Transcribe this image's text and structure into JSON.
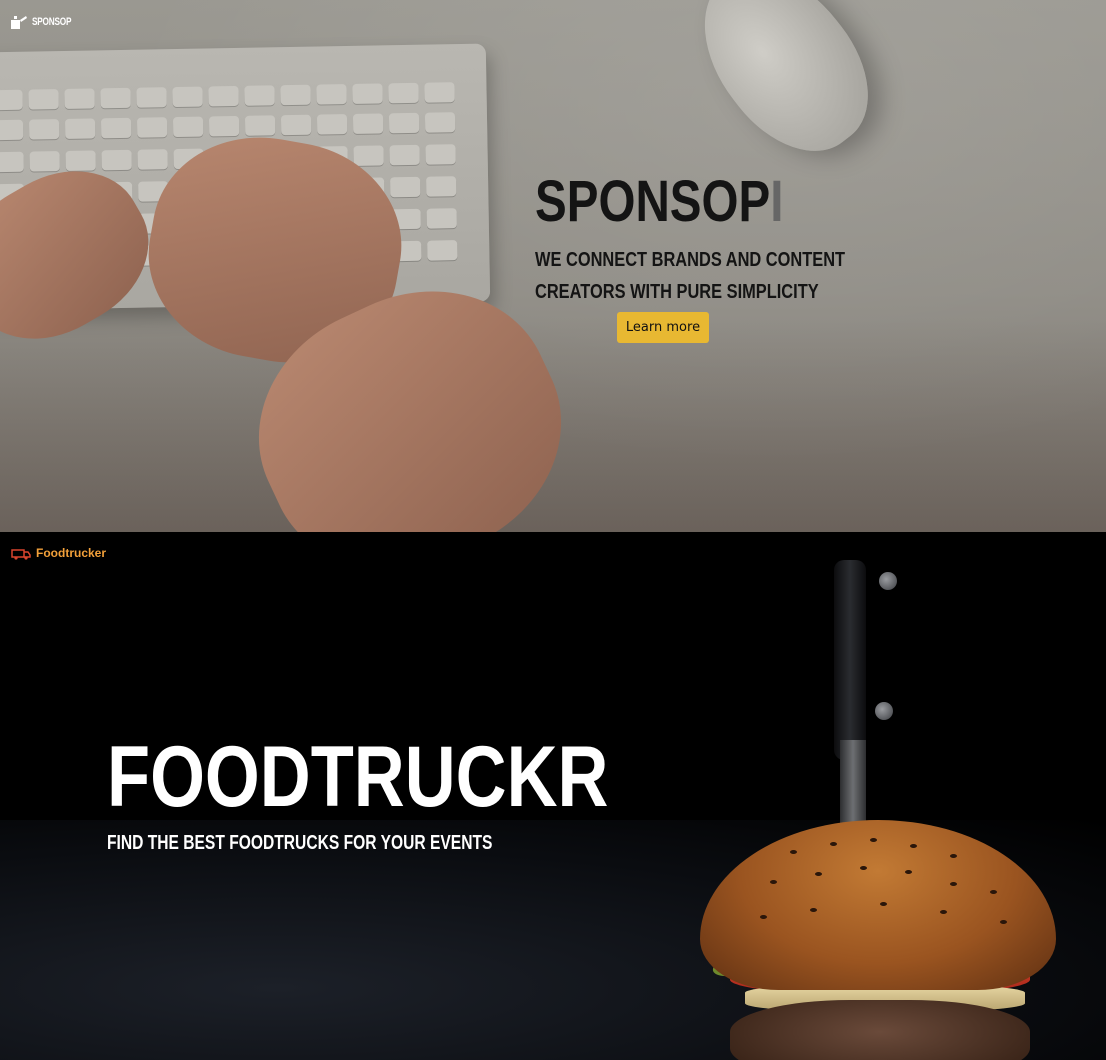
{
  "sponsop": {
    "brand_name": "SPONSOP",
    "title": "SPONSOP",
    "title_cursor": "I",
    "tagline_line1": "WE CONNECT BRANDS AND CONTENT",
    "tagline_line2": "CREATORS WITH PURE SIMPLICITY",
    "cta_label": "Learn more",
    "accent_color": "#e8b832"
  },
  "foodtruckr": {
    "brand_name": "Foodtrucker",
    "title": "FOODTRUCKR",
    "tagline": "FIND THE BEST FOODTRUCKS FOR YOUR EVENTS",
    "brand_color": "#f2a03a",
    "truck_icon": "food-truck-icon"
  }
}
